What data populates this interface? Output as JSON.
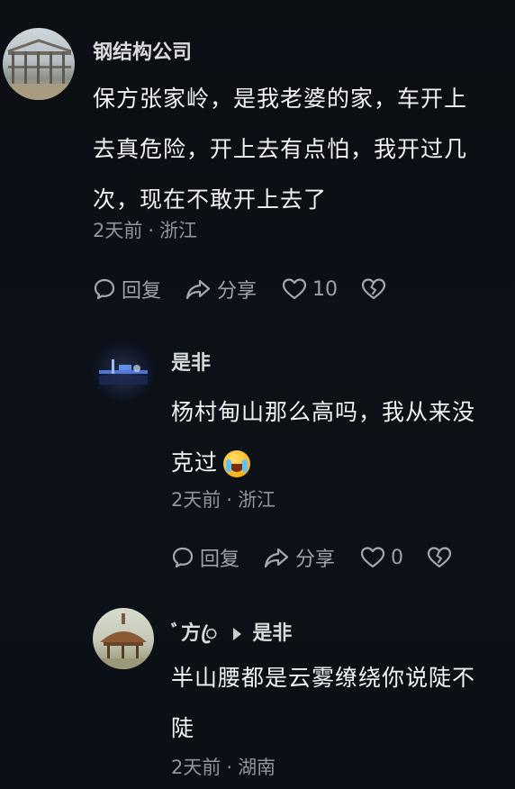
{
  "comments": [
    {
      "username": "钢结构公司",
      "text": "保方张家岭，是我老婆的家，车开上去真危险，开上去有点怕，我开过几次，现在不敢开上去了",
      "time": "2天前",
      "location": "浙江",
      "actions": {
        "reply": "回复",
        "share": "分享",
        "likes": "10"
      },
      "icons": [
        "reply-icon",
        "share-icon",
        "heart-icon",
        "broken-heart-icon"
      ],
      "avatar_icon": "steel-building-avatar"
    },
    {
      "username": "是非",
      "text": "杨村甸山那么高吗，我从来没克过",
      "emoji": "laughing-crying-emoji",
      "time": "2天前",
      "location": "浙江",
      "actions": {
        "reply": "回复",
        "share": "分享",
        "likes": "0"
      },
      "icons": [
        "reply-icon",
        "share-icon",
        "heart-icon",
        "broken-heart-icon"
      ],
      "avatar_icon": "night-lights-avatar"
    },
    {
      "username": "ﾞ方ꦿ",
      "reply_to": "是非",
      "text": "半山腰都是云雾缭绕你说陡不陡",
      "time": "2天前",
      "location": "湖南",
      "avatar_icon": "pavilion-avatar"
    }
  ],
  "separator": "·",
  "colors": {
    "background": "#0b0f14",
    "text": "#f1f2f3",
    "muted": "#8f949b",
    "icon": "#9ea3aa"
  }
}
